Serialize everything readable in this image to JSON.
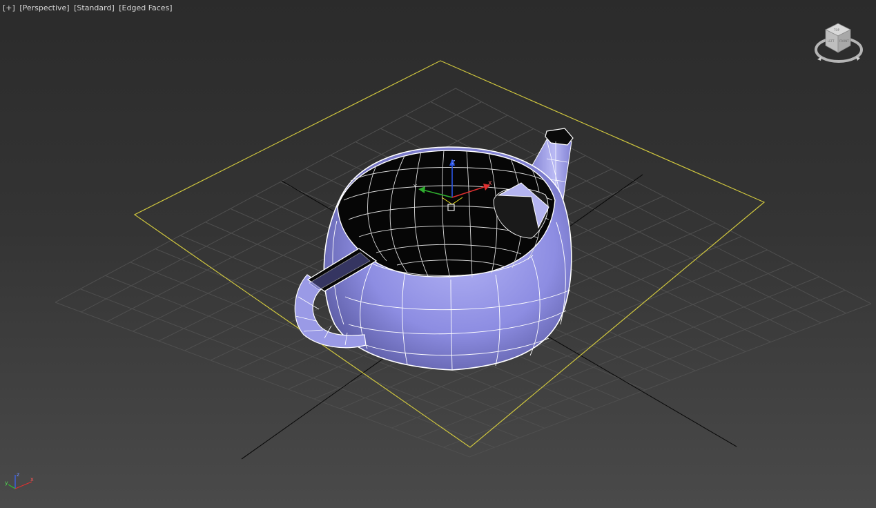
{
  "viewport": {
    "labels": [
      "[+]",
      "[Perspective]",
      "[Standard]",
      "[Edged Faces]"
    ]
  },
  "viewcube": {
    "faces": [
      "TOP",
      "LEFT",
      "FRONT"
    ]
  },
  "gizmo": {
    "axes": [
      "X",
      "Y",
      "Z"
    ]
  },
  "tripod": {
    "axes": [
      "x",
      "y",
      "z"
    ]
  },
  "colors": {
    "grid": "#4f4f4f",
    "home_grid_axis": "#0b0b0b",
    "selection_bracket": "#cfc63e",
    "teapot_fill": "#8f8fe0",
    "teapot_edges": "#ffffff",
    "x_axis": "#e03030",
    "y_axis": "#2fae2f",
    "z_axis": "#2a55e6"
  }
}
